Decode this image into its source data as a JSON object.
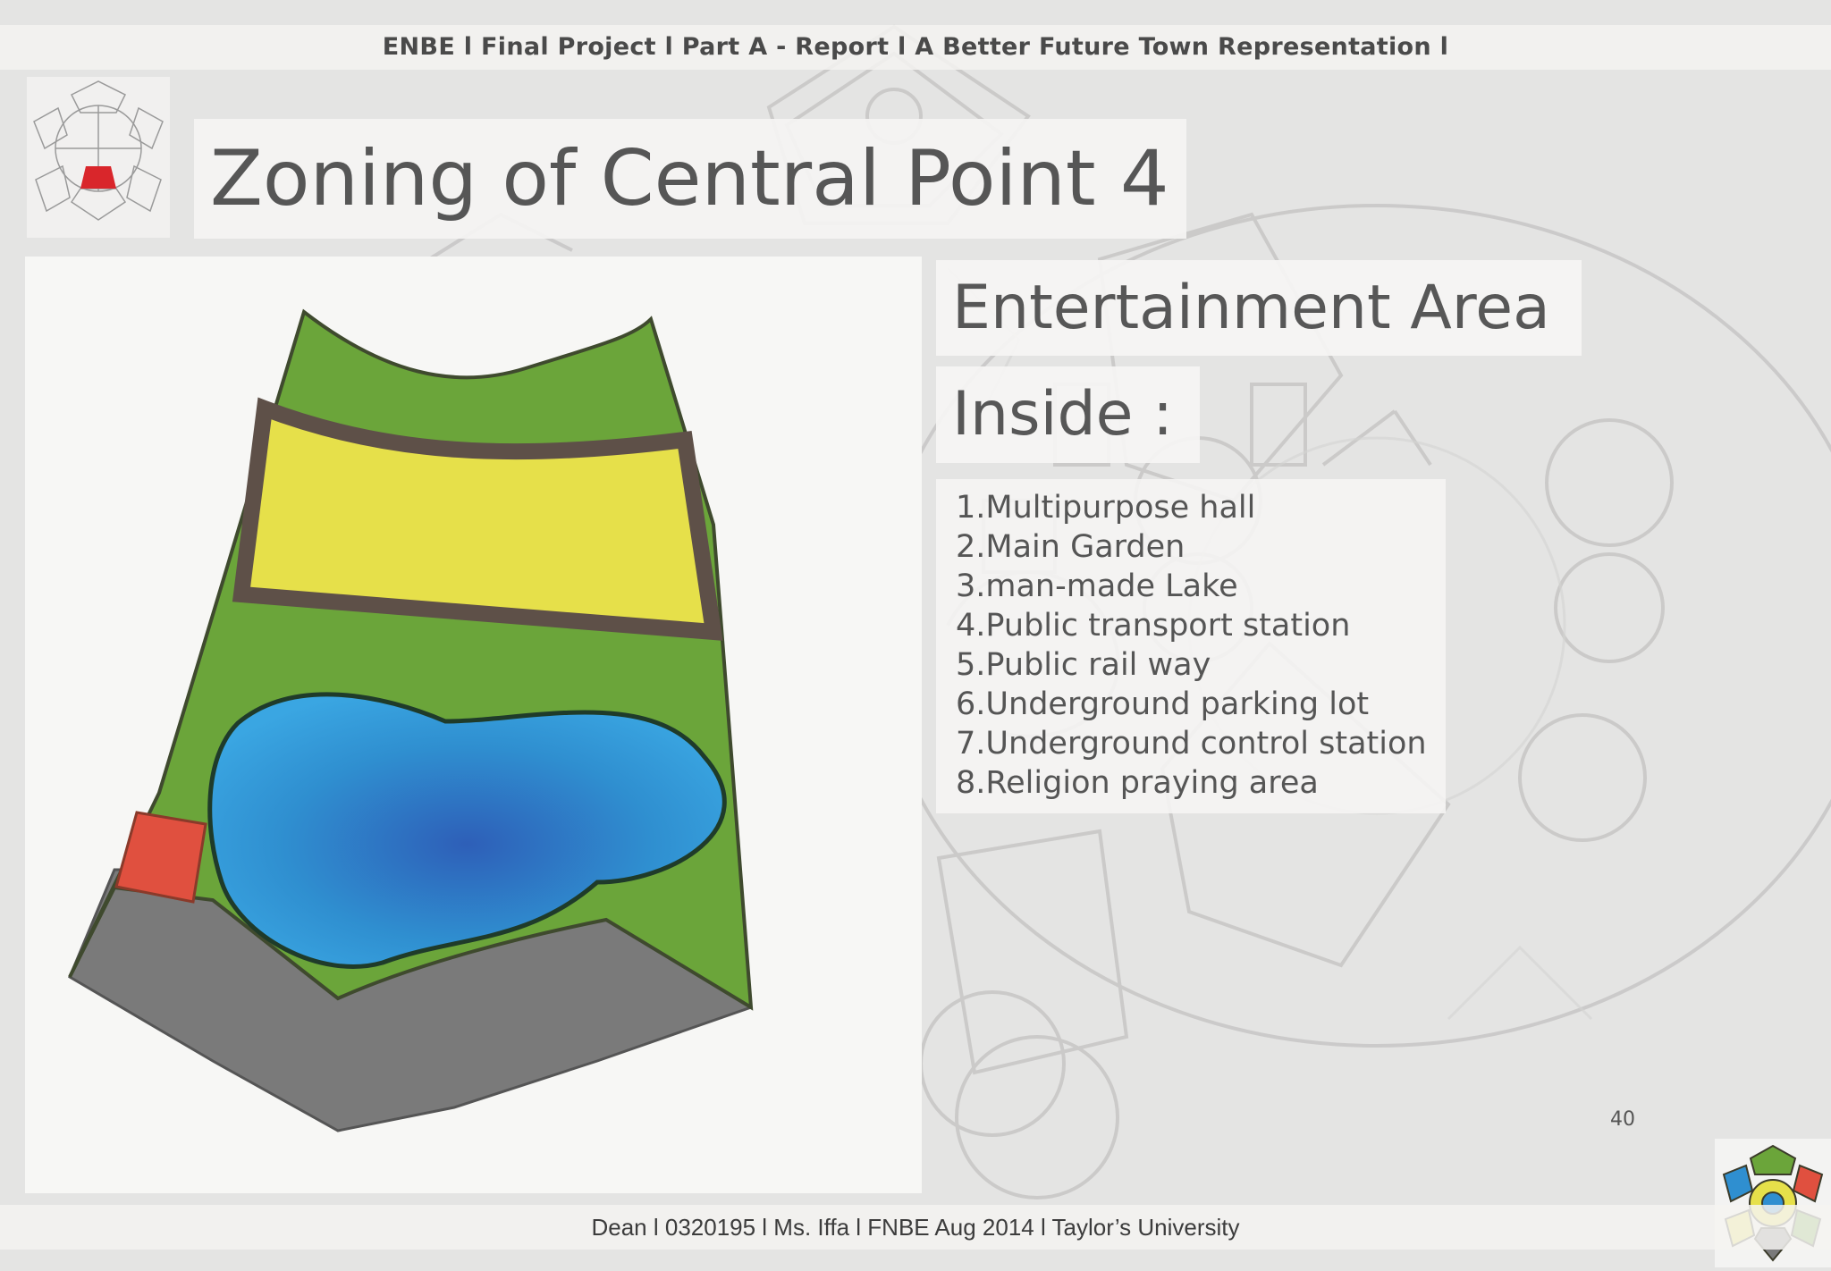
{
  "header": {
    "text": "ENBE l Final Project l Part A - Report l A Better Future Town Representation  l"
  },
  "slide": {
    "title": "Zoning of Central Point 4",
    "subtitle": "Entertainment Area",
    "inside_heading": "Inside :",
    "items": [
      "1.Multipurpose hall",
      "2.Main Garden",
      "3.man-made Lake",
      "4.Public transport station",
      "5.Public rail way",
      "6.Underground parking lot",
      "7.Underground control station",
      "8.Religion praying area"
    ],
    "page_number": "40"
  },
  "footer": {
    "text": "Dean l 0320195 l Ms. Iffa l FNBE Aug 2014 l Taylor’s University"
  },
  "colors": {
    "background": "#e4e4e3",
    "text": "#565656",
    "zone_green": "#6ba53a",
    "zone_yellow": "#e6e04a",
    "zone_blue": "#2f8fd0",
    "zone_red": "#e0503f",
    "zone_road": "#7a7a7a",
    "zone_border": "#5e5048",
    "key_highlight": "#d9262b"
  }
}
